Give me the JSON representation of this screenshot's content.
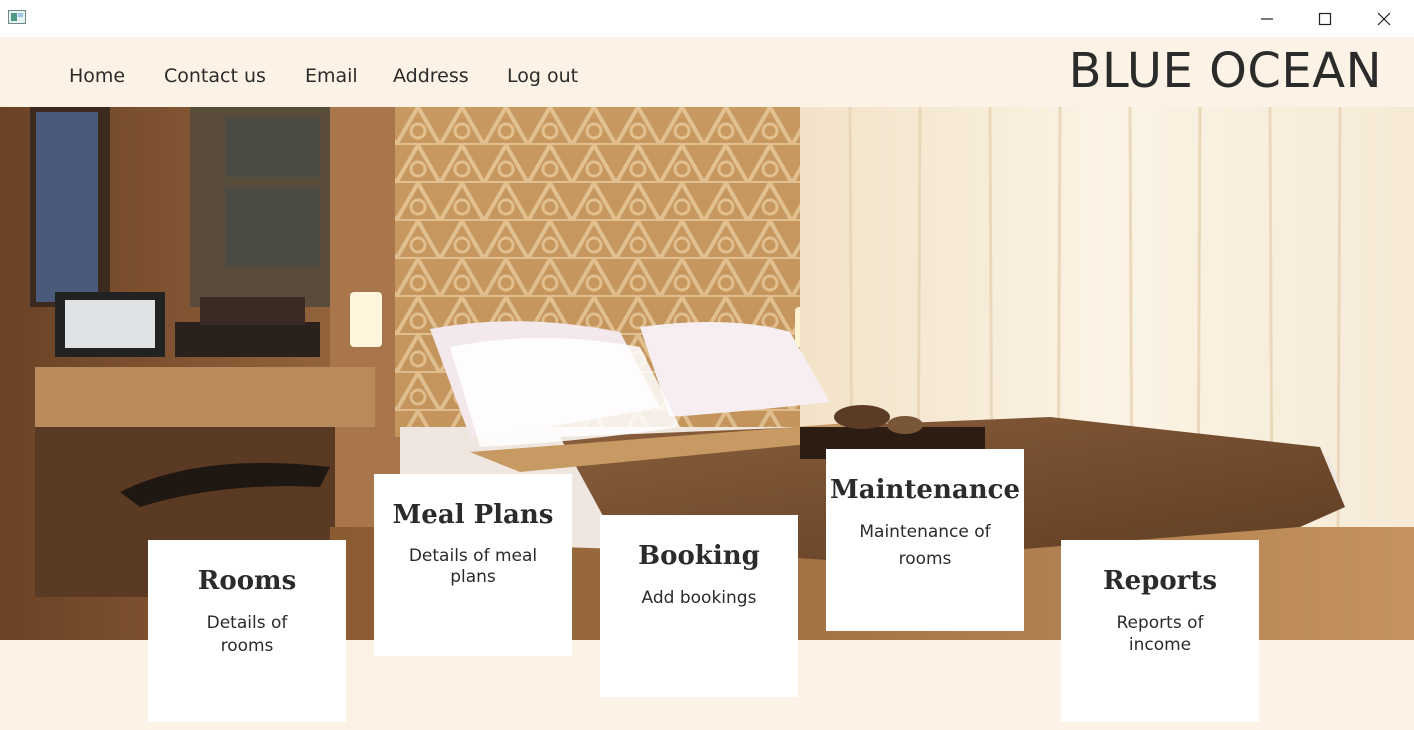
{
  "window": {
    "icon": "app-window-icon",
    "controls": [
      "minimize-icon",
      "maximize-icon",
      "close-icon"
    ]
  },
  "nav": {
    "links": [
      "Home",
      "Contact us",
      "Email",
      "Address",
      "Log out"
    ],
    "brand": "BLUE OCEAN"
  },
  "hero": {
    "image": "hotel-bedroom-photo"
  },
  "cards": [
    {
      "title": "Rooms",
      "description": "Details of rooms"
    },
    {
      "title": "Meal Plans",
      "description": "Details of meal plans"
    },
    {
      "title": "Booking",
      "description": "Add bookings"
    },
    {
      "title": "Maintenance",
      "description": "Maintenance of rooms"
    },
    {
      "title": "Reports",
      "description": "Reports of income"
    }
  ],
  "colors": {
    "background": "#fdf2e6",
    "card": "#ffffff",
    "text": "#2b2b2b"
  }
}
